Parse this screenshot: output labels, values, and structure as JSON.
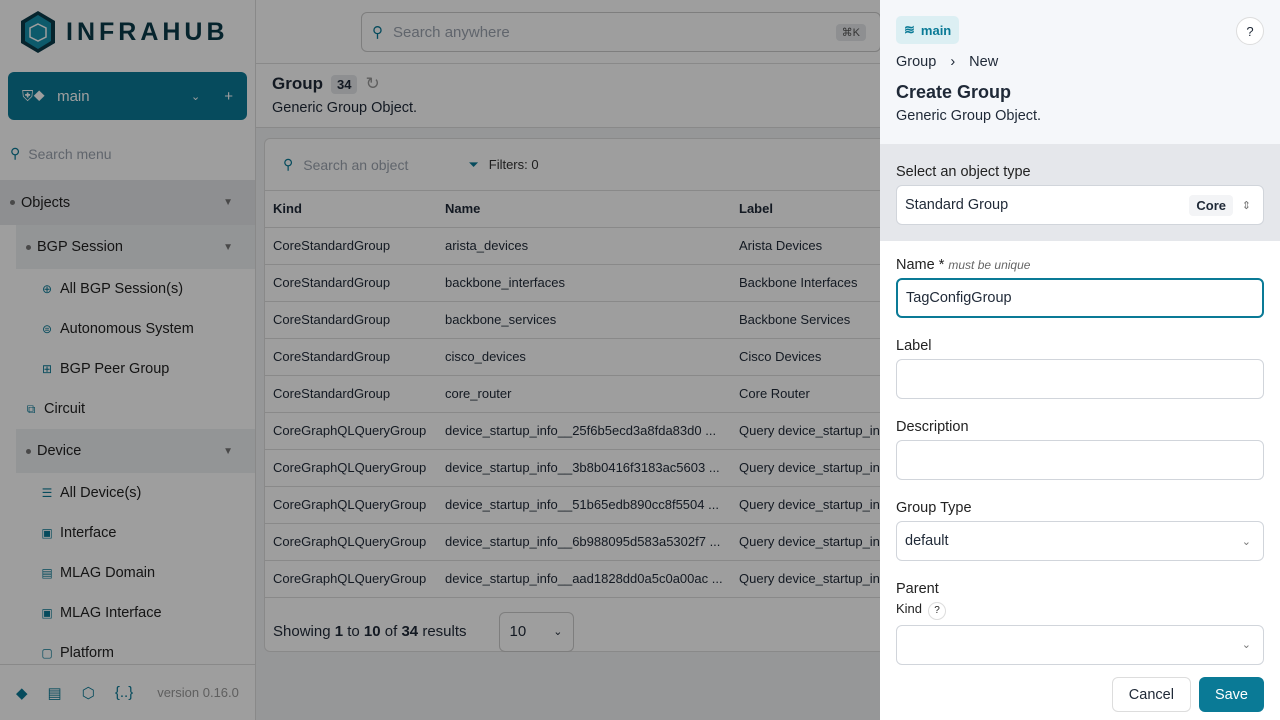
{
  "app": {
    "logo": "INFRAHUB",
    "version": "version 0.16.0"
  },
  "branch": {
    "name": "main"
  },
  "sidebar": {
    "search_placeholder": "Search menu",
    "items": [
      {
        "label": "Objects",
        "type": "top"
      },
      {
        "label": "BGP Session",
        "type": "sub"
      },
      {
        "label": "All BGP Session(s)",
        "type": "leaf",
        "icon": "globe-icon"
      },
      {
        "label": "Autonomous System",
        "type": "leaf",
        "icon": "network-icon"
      },
      {
        "label": "BGP Peer Group",
        "type": "leaf",
        "icon": "group-icon"
      },
      {
        "label": "Circuit",
        "type": "l1",
        "icon": "circuit-icon"
      },
      {
        "label": "Device",
        "type": "sub"
      },
      {
        "label": "All Device(s)",
        "type": "leaf",
        "icon": "server-icon"
      },
      {
        "label": "Interface",
        "type": "leaf",
        "icon": "interface-icon"
      },
      {
        "label": "MLAG Domain",
        "type": "leaf",
        "icon": "mlag-icon"
      },
      {
        "label": "MLAG Interface",
        "type": "leaf",
        "icon": "interface-icon"
      },
      {
        "label": "Platform",
        "type": "leaf",
        "icon": "platform-icon"
      }
    ]
  },
  "topbar": {
    "search_placeholder": "Search anywhere",
    "shortcut": "⌘K"
  },
  "list": {
    "title": "Group",
    "count": "34",
    "description": "Generic Group Object.",
    "search_placeholder": "Search an object",
    "filters": "Filters: 0",
    "columns": [
      "Kind",
      "Name",
      "Label"
    ],
    "rows": [
      [
        "CoreStandardGroup",
        "arista_devices",
        "Arista Devices"
      ],
      [
        "CoreStandardGroup",
        "backbone_interfaces",
        "Backbone Interfaces"
      ],
      [
        "CoreStandardGroup",
        "backbone_services",
        "Backbone Services"
      ],
      [
        "CoreStandardGroup",
        "cisco_devices",
        "Cisco Devices"
      ],
      [
        "CoreStandardGroup",
        "core_router",
        "Core Router"
      ],
      [
        "CoreGraphQLQueryGroup",
        "device_startup_info__25f6b5ecd3a8fda83d0 ...",
        "Query device_startup_in"
      ],
      [
        "CoreGraphQLQueryGroup",
        "device_startup_info__3b8b0416f3183ac5603 ...",
        "Query device_startup_in"
      ],
      [
        "CoreGraphQLQueryGroup",
        "device_startup_info__51b65edb890cc8f5504 ...",
        "Query device_startup_in"
      ],
      [
        "CoreGraphQLQueryGroup",
        "device_startup_info__6b988095d583a5302f7 ...",
        "Query device_startup_in"
      ],
      [
        "CoreGraphQLQueryGroup",
        "device_startup_info__aad1828dd0a5c0a00ac ...",
        "Query device_startup_in"
      ]
    ],
    "pagination": {
      "showing": "Showing",
      "from": "1",
      "to_word": "to",
      "to": "10",
      "of_word": "of",
      "total": "34",
      "results": "results",
      "page_size": "10"
    }
  },
  "drawer": {
    "branch": "main",
    "help": "?",
    "breadcrumb": [
      "Group",
      "New"
    ],
    "title": "Create Group",
    "description": "Generic Group Object.",
    "type_label": "Select an object type",
    "type_value": "Standard Group",
    "type_badge": "Core",
    "name_label": "Name *",
    "name_hint": "must be unique",
    "name_value": "TagConfigGroup",
    "label_label": "Label",
    "label_value": "",
    "description_label": "Description",
    "description_value": "",
    "group_type_label": "Group Type",
    "group_type_value": "default",
    "parent_label": "Parent",
    "kind_label": "Kind",
    "kind_value": "",
    "cancel": "Cancel",
    "save": "Save"
  },
  "colors": {
    "accent": "#0a7a96"
  }
}
